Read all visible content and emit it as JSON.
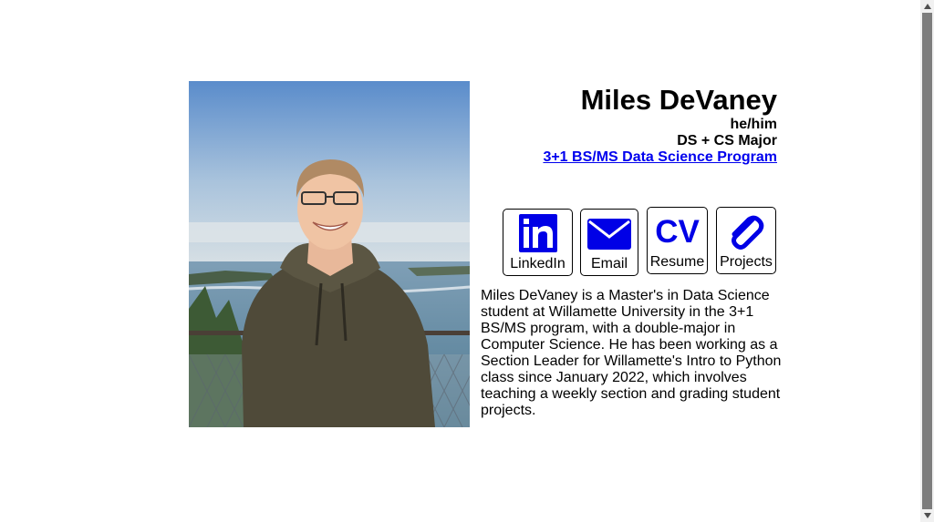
{
  "profile": {
    "name": "Miles DeVaney",
    "pronouns": "he/him",
    "major": "DS + CS Major",
    "program_link": "3+1 BS/MS Data Science Program",
    "photo": "profile-photo"
  },
  "links": {
    "linkedin": {
      "label": "LinkedIn",
      "icon": "linkedin-icon"
    },
    "email": {
      "label": "Email",
      "icon": "envelope-icon"
    },
    "resume": {
      "label": "Resume",
      "icon_text": "CV",
      "icon": "cv-icon"
    },
    "projects": {
      "label": "Projects",
      "icon": "paperclip-icon"
    }
  },
  "bio": "Miles DeVaney is a Master's in Data Science student at Willamette University in the 3+1 BS/MS program, with a double-major in Computer Science. He has been working as a Section Leader for Willamette's Intro to Python class since January 2022, which involves teaching a weekly section and grading student projects.",
  "colors": {
    "link": "#0000ee",
    "icon_blue": "#0000e6"
  }
}
